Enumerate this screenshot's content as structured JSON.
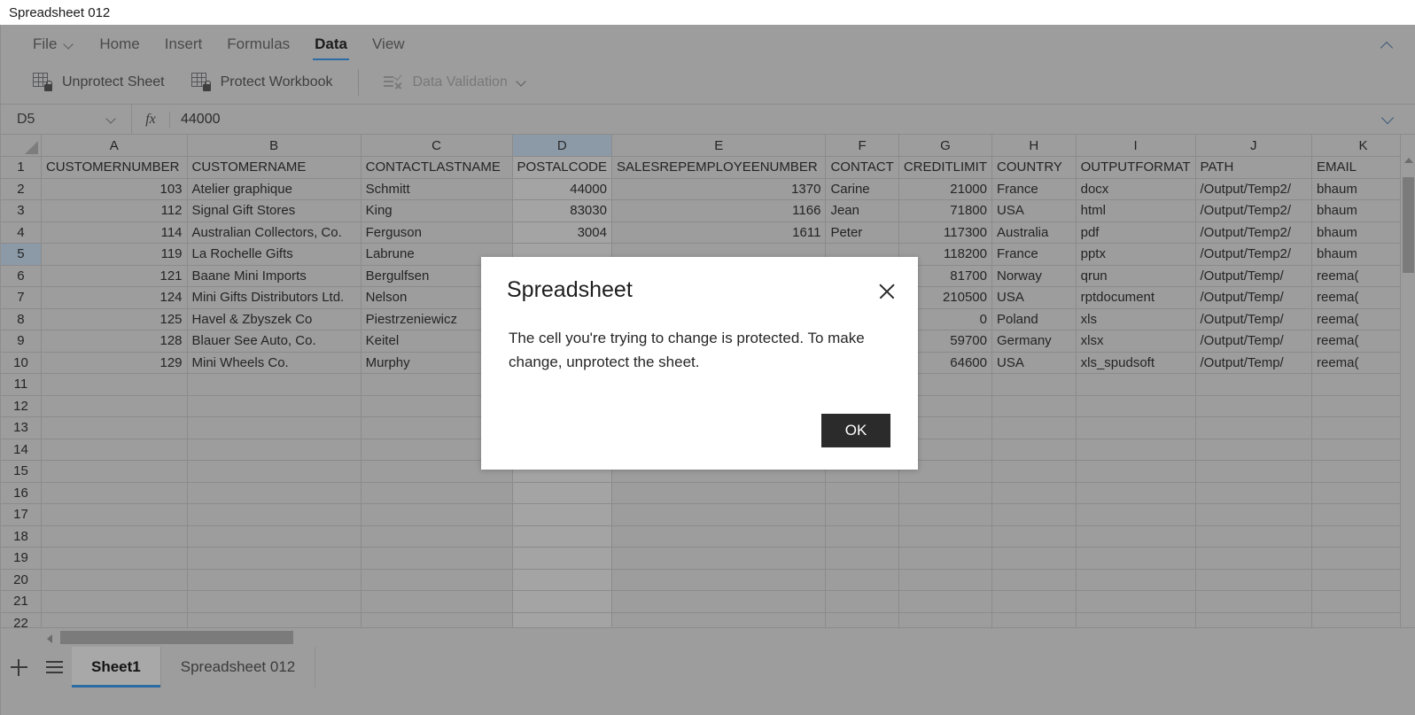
{
  "window": {
    "title": "Spreadsheet 012"
  },
  "ribbon": {
    "tabs": [
      {
        "label": "File",
        "has_caret": true,
        "active": false
      },
      {
        "label": "Home",
        "has_caret": false,
        "active": false
      },
      {
        "label": "Insert",
        "has_caret": false,
        "active": false
      },
      {
        "label": "Formulas",
        "has_caret": false,
        "active": false
      },
      {
        "label": "Data",
        "has_caret": false,
        "active": true
      },
      {
        "label": "View",
        "has_caret": false,
        "active": false
      }
    ],
    "collapse_icon": "chevron-up-icon",
    "buttons": [
      {
        "label": "Unprotect Sheet",
        "icon": "unprotect-sheet-icon",
        "disabled": false,
        "caret": false
      },
      {
        "label": "Protect Workbook",
        "icon": "protect-workbook-icon",
        "disabled": false,
        "caret": false
      },
      {
        "label": "Data Validation",
        "icon": "data-validation-icon",
        "disabled": true,
        "caret": true
      }
    ]
  },
  "formula_bar": {
    "name_box": "D5",
    "fx_label": "fx",
    "value": "44000",
    "expand_icon": "chevron-down-icon"
  },
  "grid": {
    "column_letters": [
      "A",
      "B",
      "C",
      "D",
      "E",
      "F",
      "G",
      "H",
      "I",
      "J",
      "K"
    ],
    "selected_column": "D",
    "selected_row": 5,
    "active_cell": "D5",
    "row_numbers": [
      1,
      2,
      3,
      4,
      5,
      6,
      7,
      8,
      9,
      10,
      11,
      12,
      13,
      14,
      15,
      16,
      17,
      18,
      19,
      20,
      21,
      22
    ],
    "headers": [
      "CUSTOMERNUMBER",
      "CUSTOMERNAME",
      "CONTACTLASTNAME",
      "POSTALCODE",
      "SALESREPEMPLOYEENUMBER",
      "CONTACT",
      "CREDITLIMIT",
      "COUNTRY",
      "OUTPUTFORMAT",
      "PATH",
      "EMAIL"
    ],
    "rows": [
      [
        "103",
        "Atelier graphique",
        "Schmitt",
        "44000",
        "1370",
        "Carine",
        "21000",
        "France",
        "docx",
        "/Output/Temp2/",
        "bhaum"
      ],
      [
        "112",
        "Signal Gift Stores",
        "King",
        "83030",
        "1166",
        "Jean",
        "71800",
        "USA",
        "html",
        "/Output/Temp2/",
        "bhaum"
      ],
      [
        "114",
        "Australian Collectors, Co.",
        "Ferguson",
        "3004",
        "1611",
        "Peter",
        "117300",
        "Australia",
        "pdf",
        "/Output/Temp2/",
        "bhaum"
      ],
      [
        "119",
        "La Rochelle Gifts",
        "Labrune",
        "",
        "",
        "",
        "118200",
        "France",
        "pptx",
        "/Output/Temp2/",
        "bhaum"
      ],
      [
        "121",
        "Baane Mini Imports",
        "Bergulfsen",
        "",
        "",
        "",
        "81700",
        "Norway",
        "qrun",
        "/Output/Temp/",
        "reema("
      ],
      [
        "124",
        "Mini Gifts Distributors Ltd.",
        "Nelson",
        "",
        "",
        "",
        "210500",
        "USA",
        "rptdocument",
        "/Output/Temp/",
        "reema("
      ],
      [
        "125",
        "Havel & Zbyszek Co",
        "Piestrzeniewicz",
        "",
        "",
        "",
        "0",
        "Poland",
        "xls",
        "/Output/Temp/",
        "reema("
      ],
      [
        "128",
        "Blauer See Auto, Co.",
        "Keitel",
        "",
        "",
        "",
        "59700",
        "Germany",
        "xlsx",
        "/Output/Temp/",
        "reema("
      ],
      [
        "129",
        "Mini Wheels Co.",
        "Murphy",
        "",
        "",
        "",
        "64600",
        "USA",
        "xls_spudsoft",
        "/Output/Temp/",
        "reema("
      ]
    ],
    "empty_row_count": 12
  },
  "sheet_bar": {
    "add_icon": "plus-icon",
    "list_icon": "hamburger-icon",
    "tabs": [
      {
        "label": "Sheet1",
        "active": true
      },
      {
        "label": "Spreadsheet 012",
        "active": false
      }
    ]
  },
  "dialog": {
    "title": "Spreadsheet",
    "close_icon": "close-icon",
    "message": "The cell you're trying to change is protected. To make change, unprotect the sheet.",
    "ok_label": "OK"
  },
  "colors": {
    "accent": "#2b6ca3",
    "dim_overlay": "#9d9d9d",
    "dialog_bg": "#ffffff",
    "ok_button": "#2b2b2b",
    "selection_header": "#8c9aa8"
  }
}
